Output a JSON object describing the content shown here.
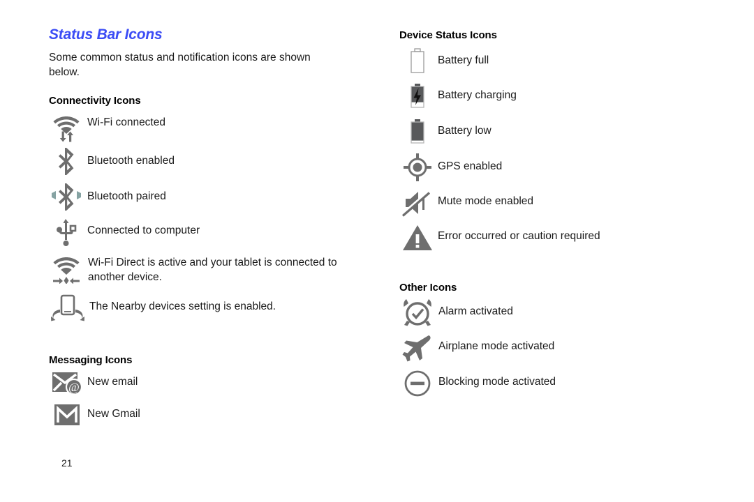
{
  "document": {
    "page_number": "21",
    "accent_color": "#3b4cf5",
    "icon_color": "#6e6e6e",
    "icon_dark_color": "#58595b",
    "text_color": "#1a1a1a"
  },
  "left_column": {
    "title": "Status Bar Icons",
    "intro": "Some common status and notification icons are shown below.",
    "connectivity": {
      "heading": "Connectivity Icons",
      "items": [
        {
          "icon": "wifi-connected-icon",
          "label": "Wi-Fi connected"
        },
        {
          "icon": "bluetooth-enabled-icon",
          "label": "Bluetooth enabled"
        },
        {
          "icon": "bluetooth-paired-icon",
          "label": "Bluetooth paired"
        },
        {
          "icon": "usb-connected-icon",
          "label": "Connected to computer"
        },
        {
          "icon": "wifi-direct-icon",
          "label": "Wi-Fi Direct is active and your tablet is connected to another device."
        },
        {
          "icon": "nearby-devices-icon",
          "label": "The Nearby devices setting is enabled."
        }
      ]
    },
    "messaging": {
      "heading": "Messaging Icons",
      "items": [
        {
          "icon": "new-email-icon",
          "label": "New email"
        },
        {
          "icon": "new-gmail-icon",
          "label": "New Gmail"
        }
      ]
    }
  },
  "right_column": {
    "device_status": {
      "heading": "Device Status Icons",
      "items": [
        {
          "icon": "battery-full-icon",
          "label": "Battery full"
        },
        {
          "icon": "battery-charging-icon",
          "label": "Battery charging"
        },
        {
          "icon": "battery-low-icon",
          "label": "Battery low"
        },
        {
          "icon": "gps-enabled-icon",
          "label": "GPS enabled"
        },
        {
          "icon": "mute-mode-icon",
          "label": "Mute mode enabled"
        },
        {
          "icon": "error-caution-icon",
          "label": "Error occurred or caution required"
        }
      ]
    },
    "other": {
      "heading": "Other Icons",
      "items": [
        {
          "icon": "alarm-activated-icon",
          "label": "Alarm activated"
        },
        {
          "icon": "airplane-mode-icon",
          "label": "Airplane mode activated"
        },
        {
          "icon": "blocking-mode-icon",
          "label": "Blocking mode activated"
        }
      ]
    }
  }
}
